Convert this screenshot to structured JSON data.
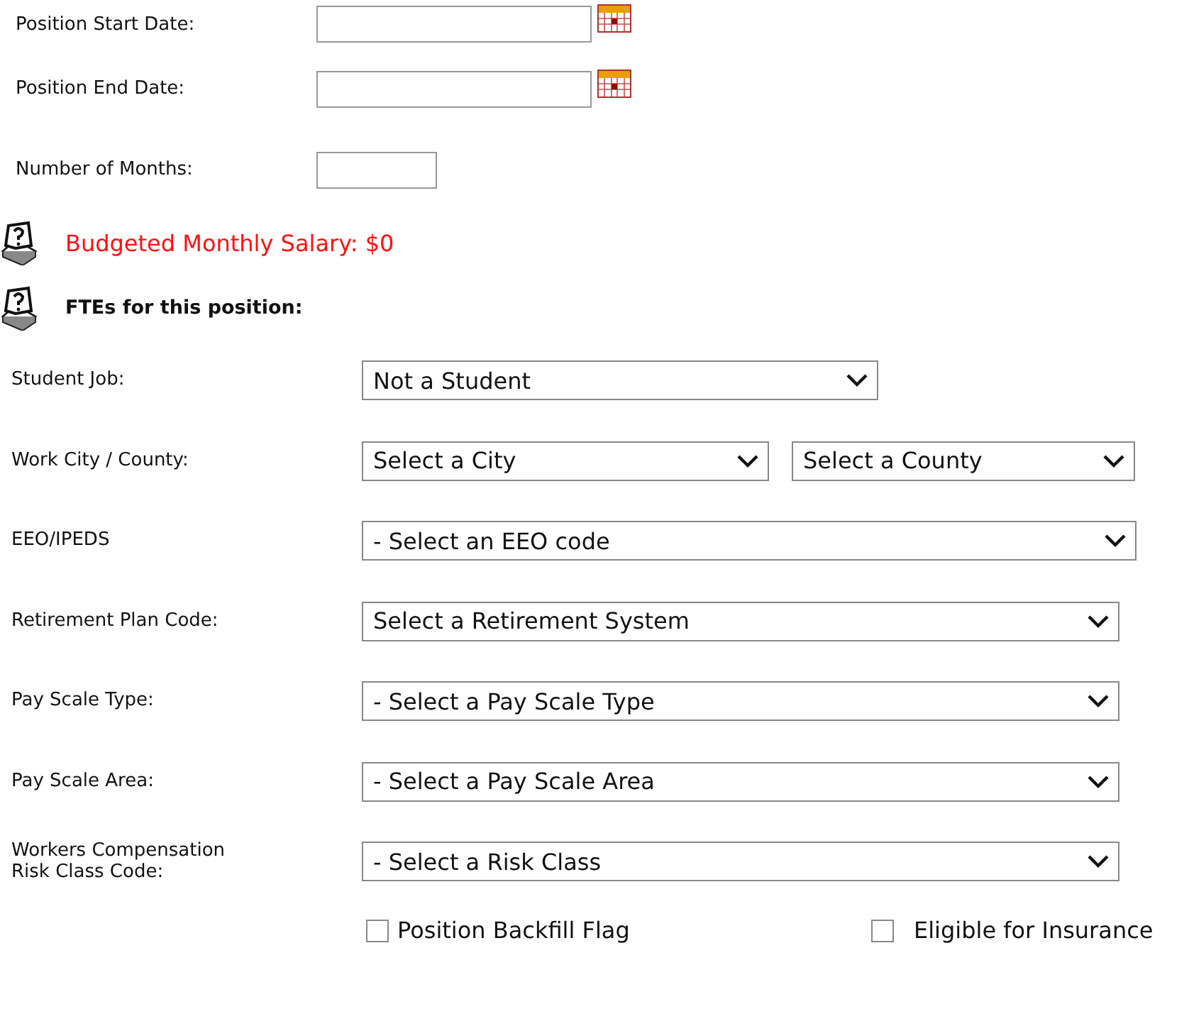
{
  "date_fields": [
    {
      "label": "Position Start Date:",
      "calendar": true
    },
    {
      "label": "Position End Date:",
      "calendar": true
    },
    {
      "label": "Number of Months:",
      "calendar": false
    }
  ],
  "notes": [
    {
      "kind": "alert",
      "text": "Budgeted Monthly Salary: $0"
    },
    {
      "kind": "heading",
      "text": "FTEs for this position:"
    }
  ],
  "select_rows": [
    {
      "label": "Student Job:",
      "selects": [
        "Not a Student"
      ]
    },
    {
      "label": "Work City / County:",
      "selects": [
        "Select a City",
        "Select a County"
      ]
    },
    {
      "label": "EEO/IPEDS",
      "selects": [
        "- Select an EEO code"
      ]
    },
    {
      "label": "Retirement Plan Code:",
      "selects": [
        "Select a Retirement System"
      ]
    },
    {
      "label": "Pay Scale Type:",
      "selects": [
        "- Select a Pay Scale Type"
      ]
    },
    {
      "label": "Pay Scale Area:",
      "selects": [
        "- Select a Pay Scale Area"
      ]
    },
    {
      "label": "Workers Compensation\nRisk Class Code:",
      "selects": [
        "- Select a Risk Class"
      ]
    }
  ],
  "checkboxes": [
    {
      "label": "Position Backfill Flag",
      "checked": false
    },
    {
      "label": "Eligible for Insurance",
      "checked": false
    }
  ]
}
